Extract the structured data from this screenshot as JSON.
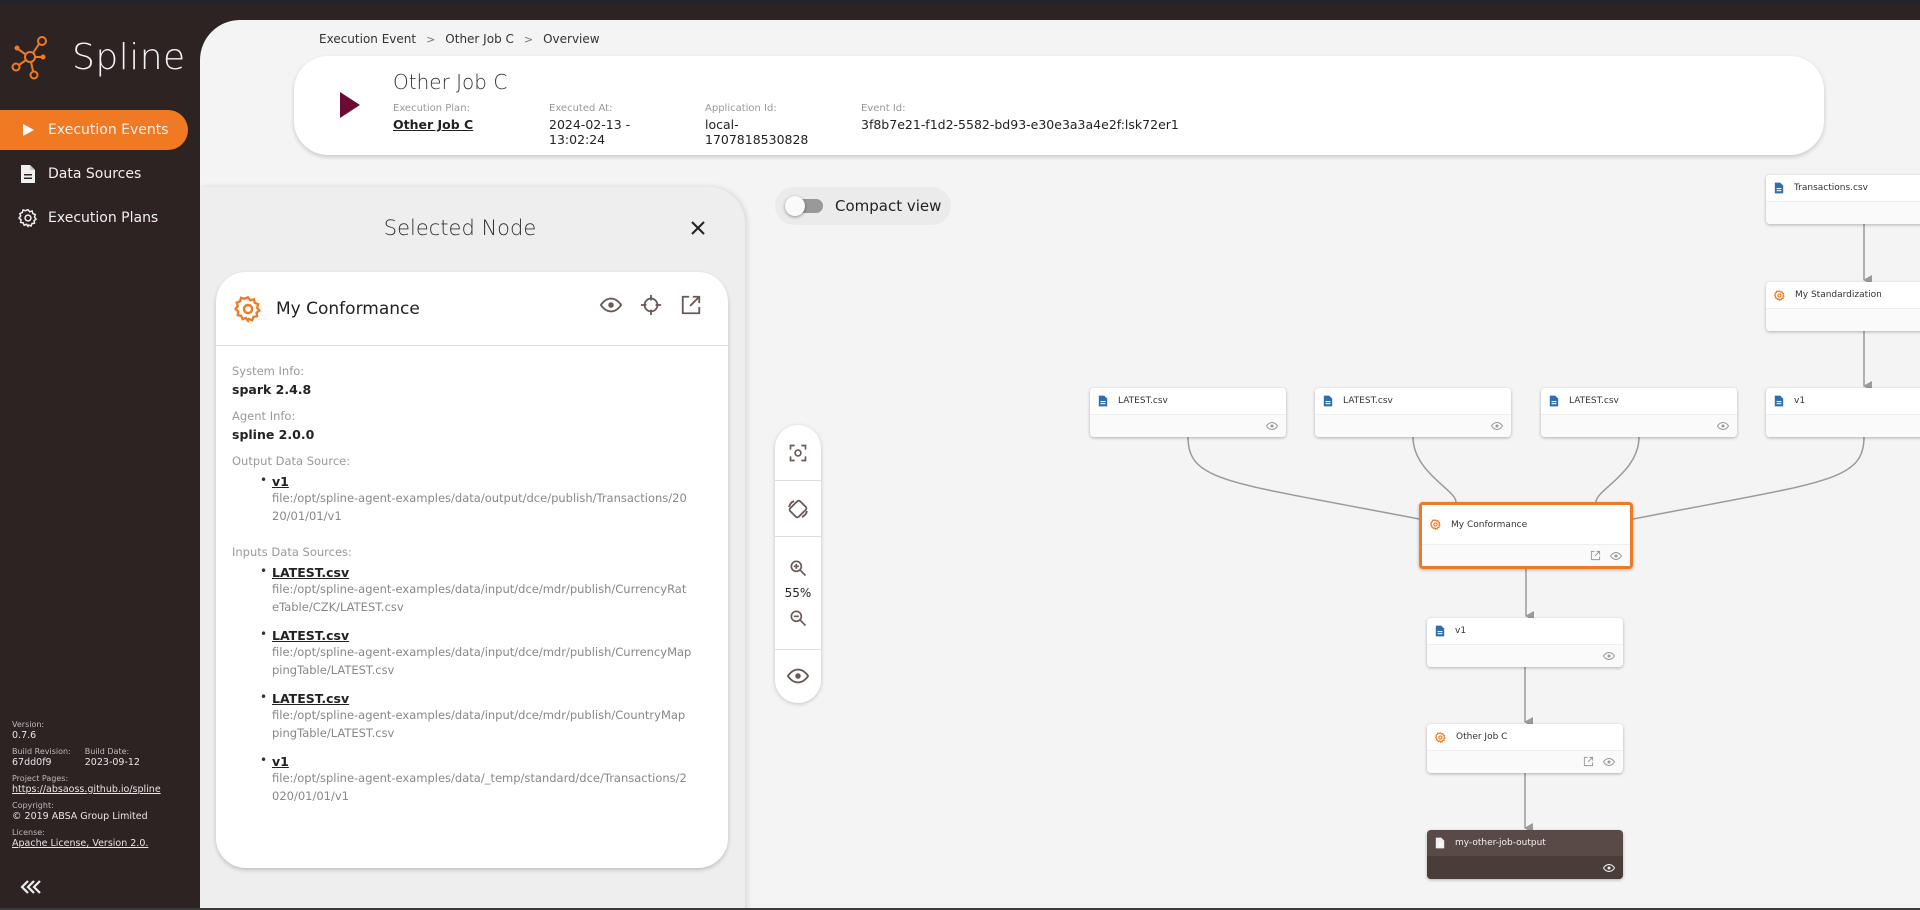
{
  "app": {
    "name": "Spline",
    "brand_color": "#f07a23",
    "sidebar_bg": "#2c2322"
  },
  "sidebar": {
    "items": [
      {
        "label": "Execution Events",
        "icon": "play-icon",
        "active": true
      },
      {
        "label": "Data Sources",
        "icon": "document-icon",
        "active": false
      },
      {
        "label": "Execution Plans",
        "icon": "gear-icon",
        "active": false
      }
    ],
    "meta": {
      "version_label": "Version:",
      "version": "0.7.6",
      "build_revision_label": "Build Revision:",
      "build_revision": "67dd0f9",
      "build_date_label": "Build Date:",
      "build_date": "2023-09-12",
      "project_pages_label": "Project Pages:",
      "project_pages": "https://absaoss.github.io/spline",
      "copyright_label": "Copyright:",
      "copyright": "© 2019 ABSA Group Limited",
      "license_label": "License:",
      "license": "Apache License, Version 2.0."
    },
    "collapse_glyph": "«"
  },
  "breadcrumb": [
    "Execution Event",
    "Other Job C",
    "Overview"
  ],
  "header": {
    "title": "Other Job C",
    "fields": [
      {
        "label": "Execution Plan:",
        "value": "Other Job C",
        "link": true
      },
      {
        "label": "Executed At:",
        "value": "2024-02-13 - 13:02:24",
        "link": false
      },
      {
        "label": "Application Id:",
        "value": "local-1707818530828",
        "link": false
      },
      {
        "label": "Event Id:",
        "value": "3f8b7e21-f1d2-5582-bd93-e30e3a3a4e2f:lsk72er1",
        "link": false
      }
    ]
  },
  "selected_node": {
    "panel_title": "Selected Node",
    "name": "My Conformance",
    "system_info_label": "System Info:",
    "system_info": "spark 2.4.8",
    "agent_info_label": "Agent Info:",
    "agent_info": "spline 2.0.0",
    "output_label": "Output Data Source:",
    "output": [
      {
        "name": "v1",
        "path": "file:/opt/spline-agent-examples/data/output/dce/publish/Transactions/2020/01/01/v1"
      }
    ],
    "inputs_label": "Inputs Data Sources:",
    "inputs": [
      {
        "name": "LATEST.csv",
        "path": "file:/opt/spline-agent-examples/data/input/dce/mdr/publish/CurrencyRateTable/CZK/LATEST.csv"
      },
      {
        "name": "LATEST.csv",
        "path": "file:/opt/spline-agent-examples/data/input/dce/mdr/publish/CurrencyMappingTable/LATEST.csv"
      },
      {
        "name": "LATEST.csv",
        "path": "file:/opt/spline-agent-examples/data/input/dce/mdr/publish/CountryMappingTable/LATEST.csv"
      },
      {
        "name": "v1",
        "path": "file:/opt/spline-agent-examples/data/_temp/standard/dce/Transactions/2020/01/01/v1"
      }
    ]
  },
  "graph": {
    "compact_view_label": "Compact view",
    "compact_view_on": false,
    "zoom_level": "55%",
    "nodes": [
      {
        "id": "transactions",
        "label": "Transactions.csv",
        "type": "datasource"
      },
      {
        "id": "standardization",
        "label": "My Standardization",
        "type": "operation"
      },
      {
        "id": "latest1",
        "label": "LATEST.csv",
        "type": "datasource"
      },
      {
        "id": "latest2",
        "label": "LATEST.csv",
        "type": "datasource"
      },
      {
        "id": "latest3",
        "label": "LATEST.csv",
        "type": "datasource"
      },
      {
        "id": "v1_in",
        "label": "v1",
        "type": "datasource"
      },
      {
        "id": "conformance",
        "label": "My Conformance",
        "type": "operation",
        "selected": true
      },
      {
        "id": "v1_out",
        "label": "v1",
        "type": "datasource"
      },
      {
        "id": "otherjob",
        "label": "Other Job C",
        "type": "operation"
      },
      {
        "id": "output",
        "label": "my-other-job-output",
        "type": "datasource",
        "current": true
      }
    ],
    "edges": [
      [
        "transactions",
        "standardization"
      ],
      [
        "standardization",
        "v1_in"
      ],
      [
        "latest1",
        "conformance"
      ],
      [
        "latest2",
        "conformance"
      ],
      [
        "latest3",
        "conformance"
      ],
      [
        "v1_in",
        "conformance"
      ],
      [
        "conformance",
        "v1_out"
      ],
      [
        "v1_out",
        "otherjob"
      ],
      [
        "otherjob",
        "output"
      ]
    ]
  }
}
